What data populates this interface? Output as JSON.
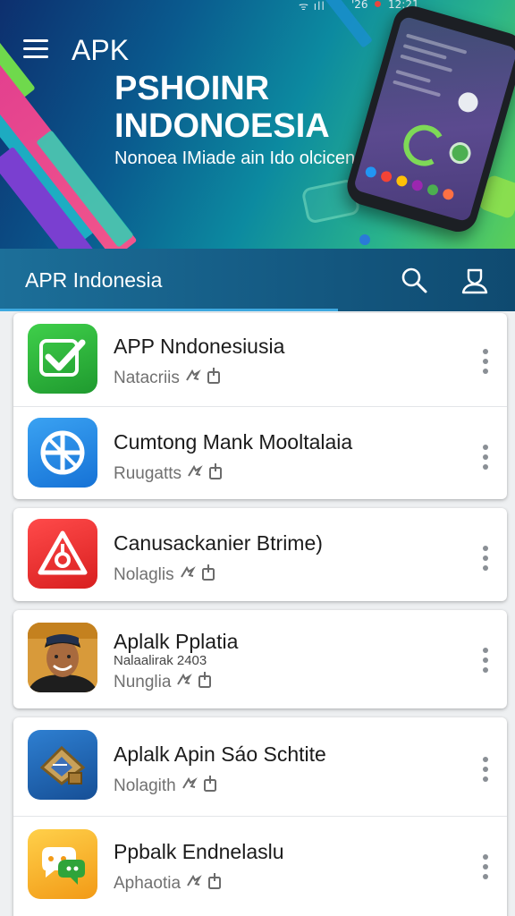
{
  "status_bar": {
    "signal": "ᯤ ıll",
    "misc": "'26",
    "time": "12:21"
  },
  "hero": {
    "brand": "APK",
    "title_line1": "PSHOINR",
    "title_line2": "INDONOESIA",
    "subtitle": "Nonoea IMiade ain Ido olcicen"
  },
  "app_bar": {
    "title": "APR Indonesia"
  },
  "apps": [
    {
      "name": "APP Nndonesiusia",
      "meta": "Natacriis",
      "extra": "",
      "icon": "check-shield-icon",
      "color": "#2faa3c"
    },
    {
      "name": "Cumtong Mank Mooltalaia",
      "meta": "Ruugatts",
      "extra": "",
      "icon": "globe-app-icon",
      "color": "#1f86e0"
    },
    {
      "name": "Canusackanier Btrime)",
      "meta": "Nolaglis",
      "extra": "",
      "icon": "warning-triangle-icon",
      "color": "#e53232"
    },
    {
      "name": "Aplalk Pplatia",
      "meta": "Nunglia",
      "extra": "Nalaalirak 2403",
      "icon": "avatar-man-icon",
      "color": "#2b2b2b"
    },
    {
      "name": "Aplalk Apin Sáo Schtite",
      "meta": "Nolagith",
      "extra": "",
      "icon": "map-house-icon",
      "color": "#1c5fa8"
    },
    {
      "name": "Ppbalk Endnelaslu",
      "meta": "Aphaotia",
      "extra": "",
      "icon": "chat-bubble-icon",
      "color": "#f7b51e"
    }
  ]
}
